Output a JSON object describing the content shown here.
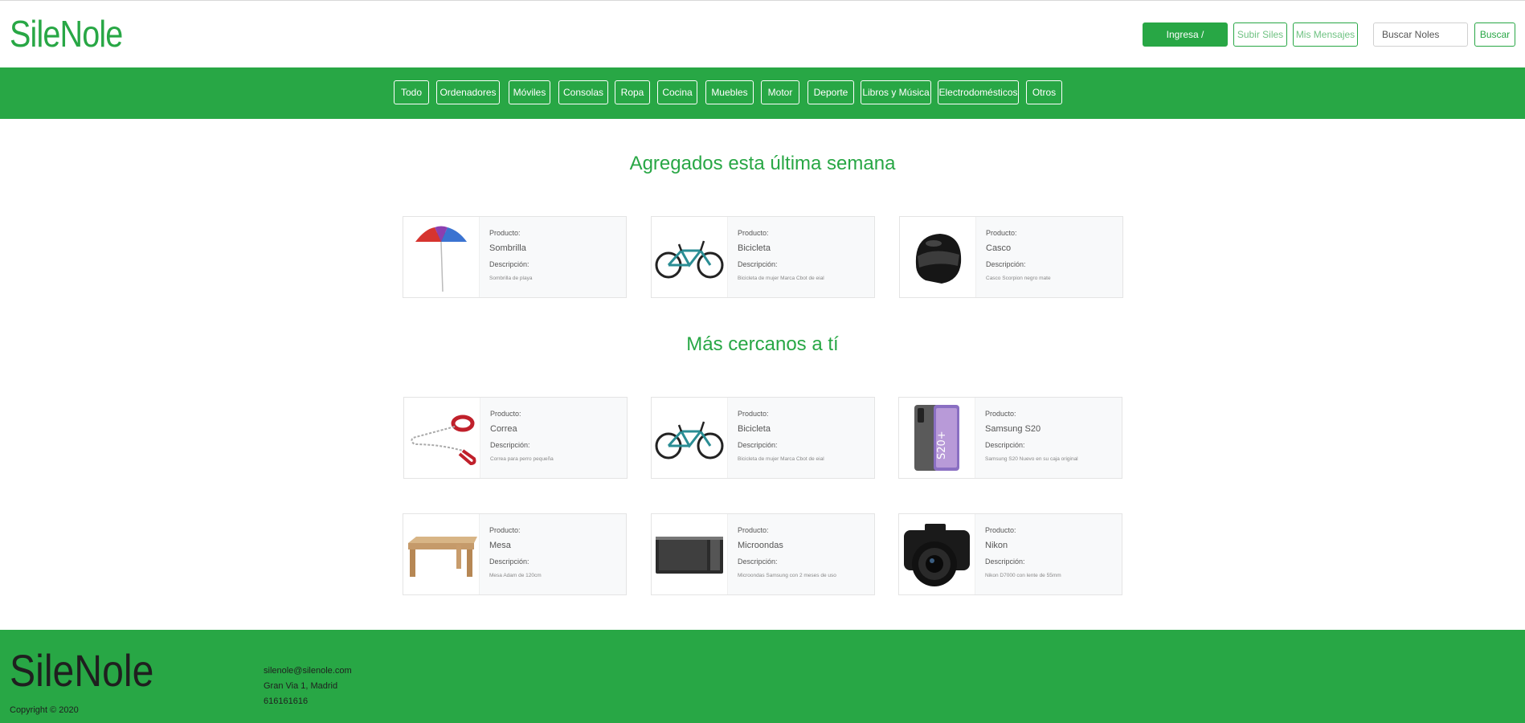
{
  "header": {
    "brand": "SileNole",
    "login_label": "Ingresa / Registrate",
    "upload_label": "Subir Siles",
    "messages_label": "Mis Mensajes",
    "search_placeholder": "Buscar Noles",
    "search_label": "Buscar"
  },
  "nav": {
    "categories": [
      "Todo",
      "Ordenadores",
      "Móviles",
      "Consolas",
      "Ropa",
      "Cocina",
      "Muebles",
      "Motor",
      "Deporte",
      "Libros y Música",
      "Electrodomésticos",
      "Otros"
    ]
  },
  "sections": {
    "latest": {
      "title": "Agregados esta última semana",
      "cards": [
        {
          "product_label": "Producto:",
          "name": "Sombrilla",
          "desc_label": "Descripción:",
          "desc": "Sombrilla de playa",
          "image": "umbrella"
        },
        {
          "product_label": "Producto:",
          "name": "Bicicleta",
          "desc_label": "Descripción:",
          "desc": "Bicicleta de mujer Marca Cbot de eial",
          "image": "bicycle"
        },
        {
          "product_label": "Producto:",
          "name": "Casco",
          "desc_label": "Descripción:",
          "desc": "Casco Scorpion negro mate",
          "image": "helmet"
        }
      ]
    },
    "nearby": {
      "title": "Más cercanos a tí",
      "cards": [
        {
          "product_label": "Producto:",
          "name": "Correa",
          "desc_label": "Descripción:",
          "desc": "Correa para perro pequeña",
          "image": "leash"
        },
        {
          "product_label": "Producto:",
          "name": "Bicicleta",
          "desc_label": "Descripción:",
          "desc": "Bicicleta de mujer Marca Cbot de eial",
          "image": "bicycle"
        },
        {
          "product_label": "Producto:",
          "name": "Samsung S20",
          "desc_label": "Descripción:",
          "desc": "Samsung S20 Nuevo en su caja original",
          "image": "phone"
        },
        {
          "product_label": "Producto:",
          "name": "Mesa",
          "desc_label": "Descripción:",
          "desc": "Mesa Adam de 120cm",
          "image": "table"
        },
        {
          "product_label": "Producto:",
          "name": "Microondas",
          "desc_label": "Descripción:",
          "desc": "Microondas Samsung con 2 meses de uso",
          "image": "microwave"
        },
        {
          "product_label": "Producto:",
          "name": "Nikon",
          "desc_label": "Descripción:",
          "desc": "Nikon D7000 con lente de 55mm",
          "image": "camera"
        }
      ]
    }
  },
  "footer": {
    "brand": "SileNole",
    "copyright": "Copyright © 2020",
    "email": "silenole@silenole.com",
    "address": "Gran Via 1, Madrid",
    "phone": "616161616"
  },
  "colors": {
    "brand_green": "#28a745"
  }
}
